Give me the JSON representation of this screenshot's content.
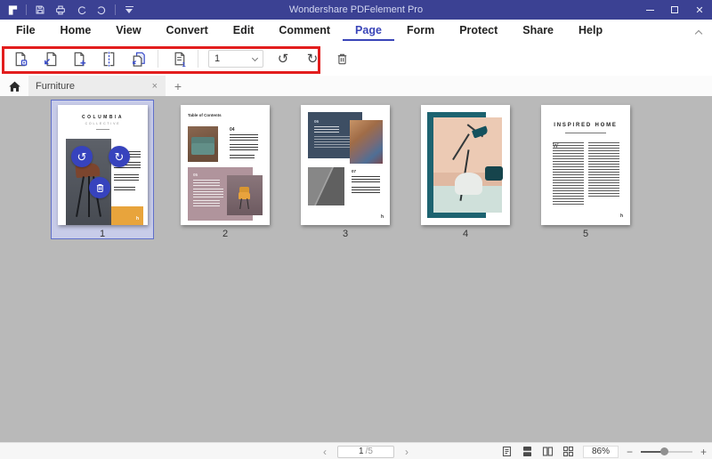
{
  "window": {
    "title": "Wondershare PDFelement Pro"
  },
  "glyphs": {
    "close_window": "✕",
    "rotate_ccw": "↺",
    "rotate_cw": "↻",
    "chevron_left": "‹",
    "chevron_right": "›",
    "tab_close": "×",
    "new_tab": "+",
    "zoom_out": "−",
    "zoom_in": "+"
  },
  "menubar": {
    "items": [
      "File",
      "Home",
      "View",
      "Convert",
      "Edit",
      "Comment",
      "Page",
      "Form",
      "Protect",
      "Share",
      "Help"
    ],
    "active": "Page"
  },
  "toolbar": {
    "page_select": {
      "value": "1"
    },
    "tools": [
      "extract-pages",
      "insert-pages",
      "add-blank-page",
      "split-document",
      "replace-pages",
      "page-labels",
      "page-number-select",
      "rotate-left",
      "rotate-right",
      "delete-pages"
    ]
  },
  "tabbar": {
    "active_tab": {
      "label": "Furniture"
    }
  },
  "canvas": {
    "pages": [
      {
        "number": "1",
        "selected": true
      },
      {
        "number": "2",
        "selected": false
      },
      {
        "number": "3",
        "selected": false
      },
      {
        "number": "4",
        "selected": false
      },
      {
        "number": "5",
        "selected": false
      }
    ],
    "page1": {
      "title": "COLUMBIA",
      "subtitle": "COLLECTIVE",
      "brand": "h"
    },
    "page2": {
      "heading": "Table of Contents",
      "toc1": "04",
      "toc2": "05"
    },
    "page3": {
      "sec1": "06",
      "sec2": "07",
      "brand": "h"
    },
    "page5": {
      "title": "INSPIRED HOME",
      "dropcap": "W",
      "brand": "h"
    }
  },
  "statusbar": {
    "page_current": "1",
    "page_total": "/5",
    "zoom_level": "86%"
  },
  "colors": {
    "titlebar": "#3B4193",
    "accent": "#3A45B8",
    "annotation_red": "#E21D1D",
    "canvas_bg": "#B9B9B9",
    "selection_fill": "#C8CCE9",
    "selection_border": "#5F6FC9",
    "overlay_circle": "#3743BD",
    "orange_block": "#E8A43C",
    "mauve_block": "#B0949C",
    "slate_block": "#3D4E63",
    "teal_block": "#1D6370"
  }
}
